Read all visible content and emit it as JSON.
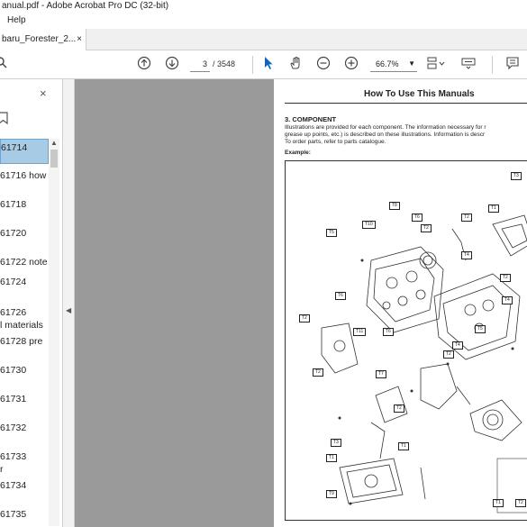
{
  "window": {
    "title": "anual.pdf - Adobe Acrobat Pro DC (32-bit)"
  },
  "menu": {
    "help": "Help"
  },
  "tab": {
    "label": "baru_Forester_2...",
    "close": "×"
  },
  "toolbar": {
    "page_current": "3",
    "page_count": "/ 3548",
    "zoom": "66.7%"
  },
  "sidebar": {
    "close": "×",
    "bookmarks": [
      {
        "line1": "61714",
        "line2": ""
      },
      {
        "line1": "61716 how",
        "line2": ""
      },
      {
        "line1": "61718",
        "line2": ""
      },
      {
        "line1": "61720",
        "line2": ""
      },
      {
        "line1": "61722 note",
        "line2": ""
      },
      {
        "line1": "61724",
        "line2": ""
      },
      {
        "line1": "61726",
        "line2": "l materials"
      },
      {
        "line1": "61728 pre",
        "line2": ""
      },
      {
        "line1": "61730",
        "line2": ""
      },
      {
        "line1": "61731",
        "line2": ""
      },
      {
        "line1": "61732",
        "line2": ""
      },
      {
        "line1": "61733",
        "line2": "r"
      },
      {
        "line1": "61734",
        "line2": ""
      },
      {
        "line1": "61735",
        "line2": ""
      }
    ]
  },
  "document": {
    "header": "How To Use This Manuals",
    "section": "3.  COMPONENT",
    "lines": [
      "Illustrations are provided for each component. The information necessary for r",
      "grease up points, etc.) is described on these illustrations. Information is descr",
      "To order parts, refer to parts catalogue."
    ],
    "example": "Example:",
    "figure_labels": [
      "T3",
      "T8",
      "T6",
      "T2",
      "T10",
      "T5",
      "T1",
      "T2",
      "T4",
      "T6",
      "T2",
      "T4",
      "T11",
      "T6",
      "T5",
      "T4",
      "T2",
      "T2",
      "T7",
      "T2",
      "T2",
      "T3",
      "T1",
      "T1",
      "T9",
      "T1",
      "T2"
    ]
  }
}
